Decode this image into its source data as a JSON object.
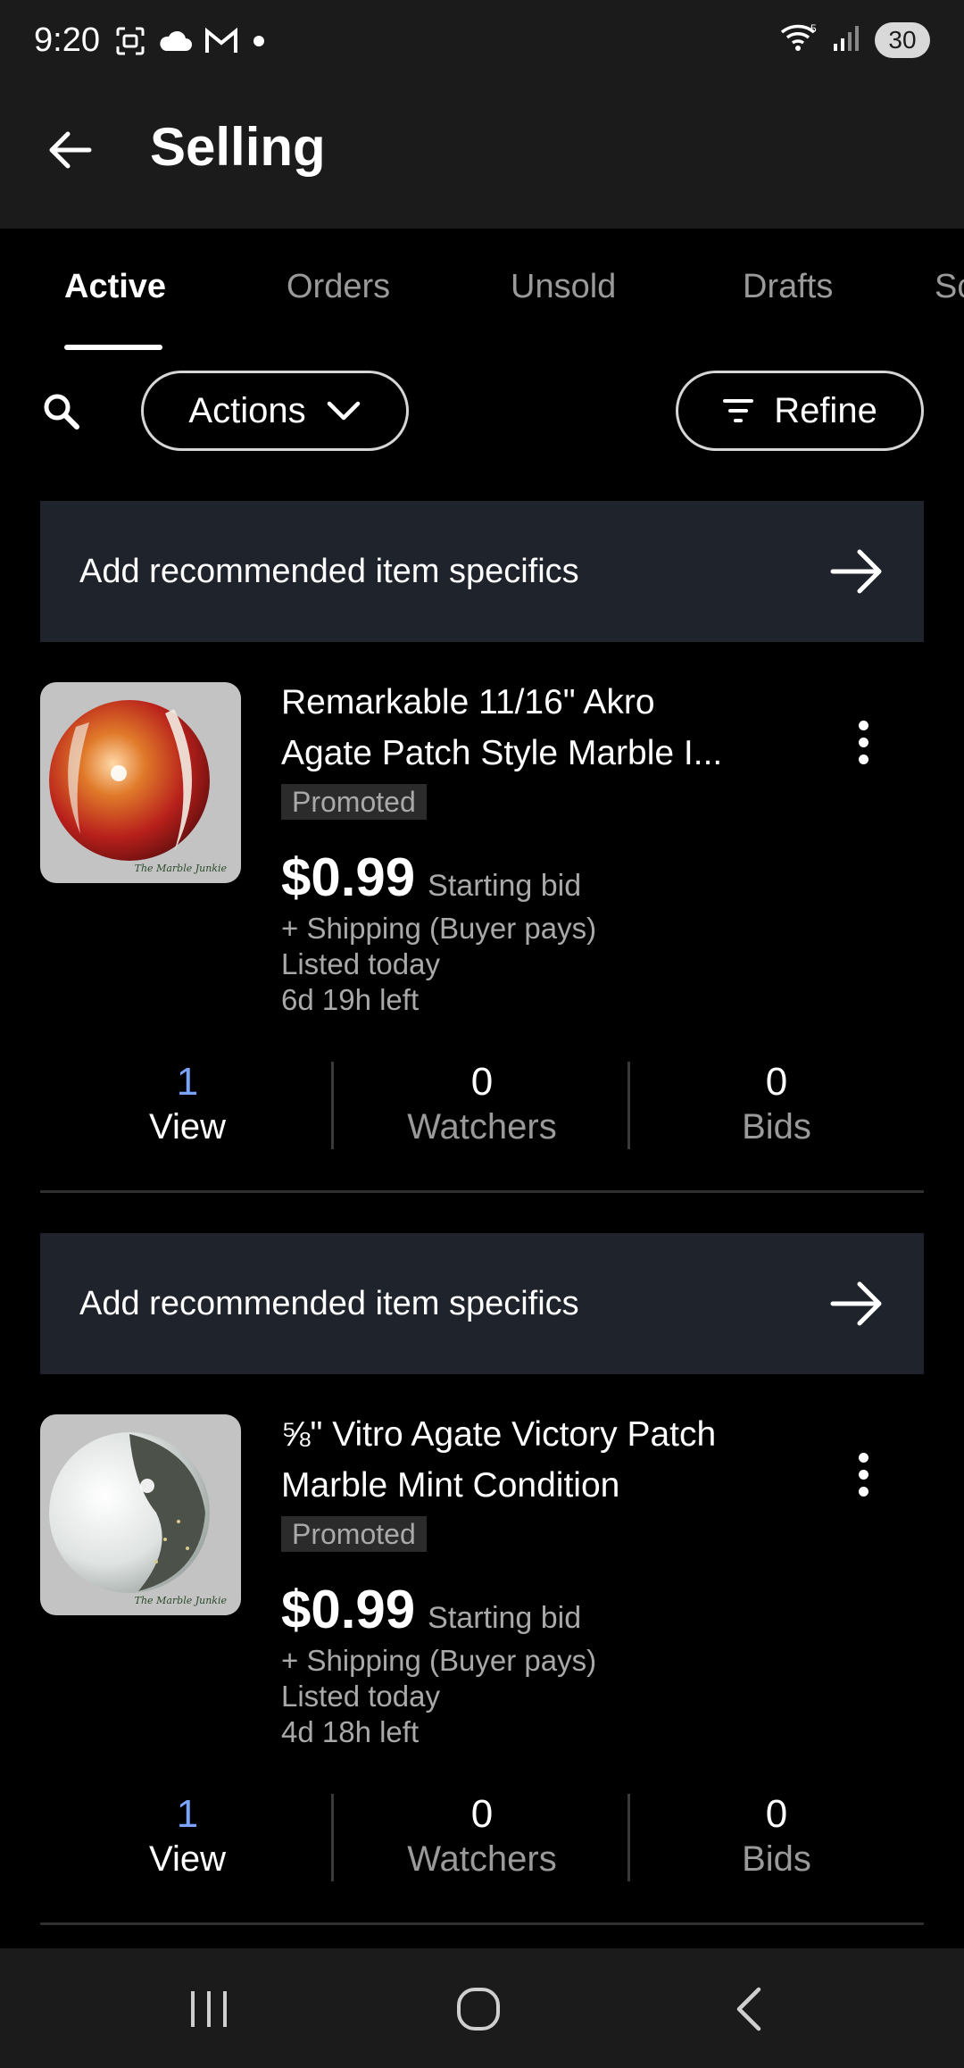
{
  "status_bar": {
    "time": "9:20",
    "battery": "30",
    "icons": [
      "screenshot-icon",
      "cloud-icon",
      "gmail-icon",
      "notification-dot-icon",
      "wifi-icon",
      "signal-icon",
      "battery-icon"
    ]
  },
  "app_bar": {
    "title": "Selling"
  },
  "tabs": [
    "Active",
    "Orders",
    "Unsold",
    "Drafts",
    "Sc"
  ],
  "toolbar": {
    "actions_label": "Actions",
    "refine_label": "Refine"
  },
  "listings": [
    {
      "banner": "Add recommended item specifics",
      "title_line1": "Remarkable 11/16\" Akro",
      "title_line2": "Agate Patch Style Marble I...",
      "badge": "Promoted",
      "price": "$0.99",
      "price_type": "Starting bid",
      "shipping": "+ Shipping (Buyer pays)",
      "listed": "Listed today",
      "time_left": "6d 19h left",
      "thumb_caption": "The Marble Junkie",
      "stats": {
        "views": "1",
        "views_label": "View",
        "watchers": "0",
        "watchers_label": "Watchers",
        "bids": "0",
        "bids_label": "Bids"
      }
    },
    {
      "banner": "Add recommended item specifics",
      "title_line1": "⅝\" Vitro Agate Victory Patch",
      "title_line2": "Marble Mint Condition",
      "badge": "Promoted",
      "price": "$0.99",
      "price_type": "Starting bid",
      "shipping": "+ Shipping (Buyer pays)",
      "listed": "Listed today",
      "time_left": "4d 18h left",
      "thumb_caption": "The Marble Junkie",
      "stats": {
        "views": "1",
        "views_label": "View",
        "watchers": "0",
        "watchers_label": "Watchers",
        "bids": "0",
        "bids_label": "Bids"
      }
    }
  ],
  "colors": {
    "background": "#000000",
    "bar": "#1b1b1b",
    "banner": "#1f232b",
    "view_count": "#7aa4ff"
  }
}
